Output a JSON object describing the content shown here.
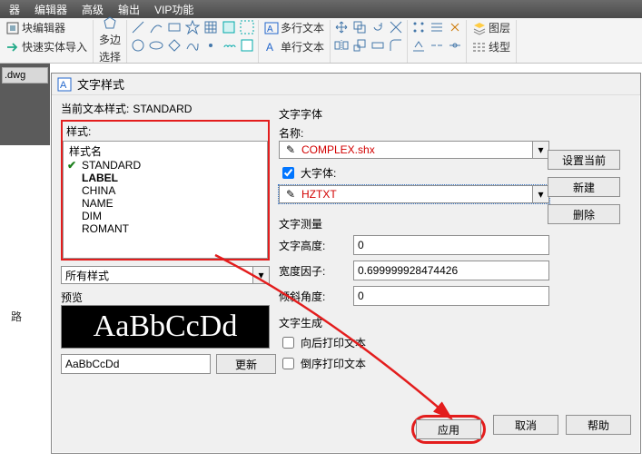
{
  "menubar": [
    "器",
    "编辑器",
    "高级",
    "输出",
    "VIP功能"
  ],
  "ribbon": {
    "block_editor": "块编辑器",
    "quick_import": "快速实体导入",
    "multi_select": "多边",
    "select": "选择",
    "mtext": "多行文本",
    "stext": "单行文本",
    "layer": "图层",
    "ltype": "线型"
  },
  "dwg_name": ".dwg",
  "side_label": "路",
  "dialog": {
    "title": "文字样式",
    "current_label": "当前文本样式:",
    "current_value": "STANDARD",
    "styles_label": "样式:",
    "style_header": "样式名",
    "styles": [
      {
        "name": "STANDARD",
        "current": true,
        "bold": false
      },
      {
        "name": "LABEL",
        "current": false,
        "bold": true
      },
      {
        "name": "CHINA",
        "current": false,
        "bold": false
      },
      {
        "name": "NAME",
        "current": false,
        "bold": false
      },
      {
        "name": "DIM",
        "current": false,
        "bold": false
      },
      {
        "name": "ROMANT",
        "current": false,
        "bold": false
      }
    ],
    "all_styles": "所有样式",
    "preview_label": "预览",
    "preview_big": "AaBbCcDd",
    "preview_text": "AaBbCcDd",
    "update_btn": "更新",
    "font_group": "文字字体",
    "font_name_label": "名称:",
    "font_name": "COMPLEX.shx",
    "bigfont_check": "大字体:",
    "bigfont": "HZTXT",
    "measure_group": "文字测量",
    "height_label": "文字高度:",
    "height_value": "0",
    "width_label": "宽度因子:",
    "width_value": "0.699999928474426",
    "oblique_label": "倾斜角度:",
    "oblique_value": "0",
    "gen_group": "文字生成",
    "backward": "向后打印文本",
    "upside": "倒序打印文本",
    "set_current": "设置当前",
    "new_btn": "新建",
    "delete_btn": "删除",
    "apply": "应用",
    "cancel": "取消",
    "help": "帮助"
  }
}
